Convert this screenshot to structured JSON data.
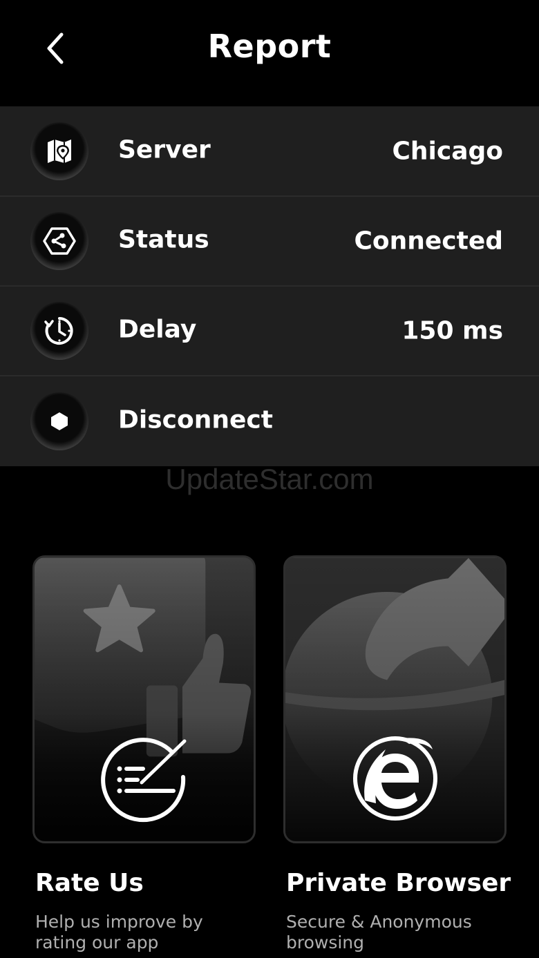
{
  "header": {
    "title": "Report"
  },
  "report": {
    "rows": [
      {
        "label": "Server",
        "value": "Chicago",
        "icon": "map-pin-icon"
      },
      {
        "label": "Status",
        "value": "Connected",
        "icon": "network-hexagon-icon"
      },
      {
        "label": "Delay",
        "value": "150 ms",
        "icon": "timer-icon"
      },
      {
        "label": "Disconnect",
        "value": "",
        "icon": "stop-hexagon-icon"
      }
    ]
  },
  "watermark": "UpdateStar.com",
  "cards": [
    {
      "title": "Rate Us",
      "subtitle": "Help us improve by rating our app",
      "icon": "rate-note-icon"
    },
    {
      "title": "Private Browser",
      "subtitle": "Secure & Anonymous browsing",
      "icon": "browser-e-icon"
    }
  ],
  "colors": {
    "background": "#000000",
    "list_bg": "#1f1f1f",
    "text": "#ffffff",
    "subtext": "#b0b0b0"
  }
}
